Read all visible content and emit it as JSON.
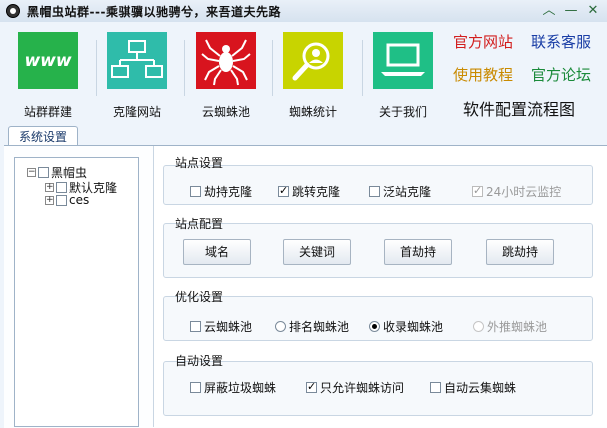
{
  "window": {
    "title": "黑帽虫站群---乘骐骥以驰骋兮，来吾道夫先路",
    "controls": {
      "collapse": "︿",
      "minimize": "—",
      "close": "✕"
    }
  },
  "toolbar": {
    "items": [
      {
        "label": "站群群建",
        "icon": "www-icon",
        "tile_text": "www"
      },
      {
        "label": "克隆网站",
        "icon": "network-clone-icon"
      },
      {
        "label": "云蜘蛛池",
        "icon": "spider-icon"
      },
      {
        "label": "蜘蛛统计",
        "icon": "search-user-icon"
      },
      {
        "label": "关于我们",
        "icon": "laptop-icon"
      }
    ],
    "links": [
      {
        "label": "官方网站",
        "color": "#d21e1e"
      },
      {
        "label": "联系客服",
        "color": "#1a3ea6"
      },
      {
        "label": "使用教程",
        "color": "#c98a00"
      },
      {
        "label": "官方论坛",
        "color": "#1a8a3a"
      }
    ],
    "flow_link": "软件配置流程图"
  },
  "tabs": [
    {
      "label": "系统设置",
      "active": true
    }
  ],
  "tree": {
    "root": {
      "label": "黑帽虫",
      "expanded": true,
      "checked": false
    },
    "children": [
      {
        "label": "默认克隆",
        "checked": false
      },
      {
        "label": "ces",
        "checked": false
      }
    ]
  },
  "site_settings": {
    "title": "站点设置",
    "options": [
      {
        "label": "劫持克隆",
        "checked": false,
        "enabled": true
      },
      {
        "label": "跳转克隆",
        "checked": true,
        "enabled": true
      },
      {
        "label": "泛站克隆",
        "checked": false,
        "enabled": true
      },
      {
        "label": "24小时云监控",
        "checked": true,
        "enabled": false
      }
    ]
  },
  "site_config": {
    "title": "站点配置",
    "buttons": [
      "域名",
      "关键词",
      "首劫持",
      "跳劫持"
    ]
  },
  "optimize": {
    "title": "优化设置",
    "options": [
      {
        "label": "云蜘蛛池",
        "type": "checkbox",
        "checked": false,
        "enabled": true
      },
      {
        "label": "排名蜘蛛池",
        "type": "radio",
        "checked": false,
        "enabled": true
      },
      {
        "label": "收录蜘蛛池",
        "type": "radio",
        "checked": true,
        "enabled": true
      },
      {
        "label": "外推蜘蛛池",
        "type": "radio",
        "checked": false,
        "enabled": false
      }
    ]
  },
  "auto": {
    "title": "自动设置",
    "options": [
      {
        "label": "屏蔽垃圾蜘蛛",
        "checked": false,
        "enabled": true
      },
      {
        "label": "只允许蜘蛛访问",
        "checked": true,
        "enabled": true
      },
      {
        "label": "自动云集蜘蛛",
        "checked": false,
        "enabled": true
      }
    ]
  }
}
